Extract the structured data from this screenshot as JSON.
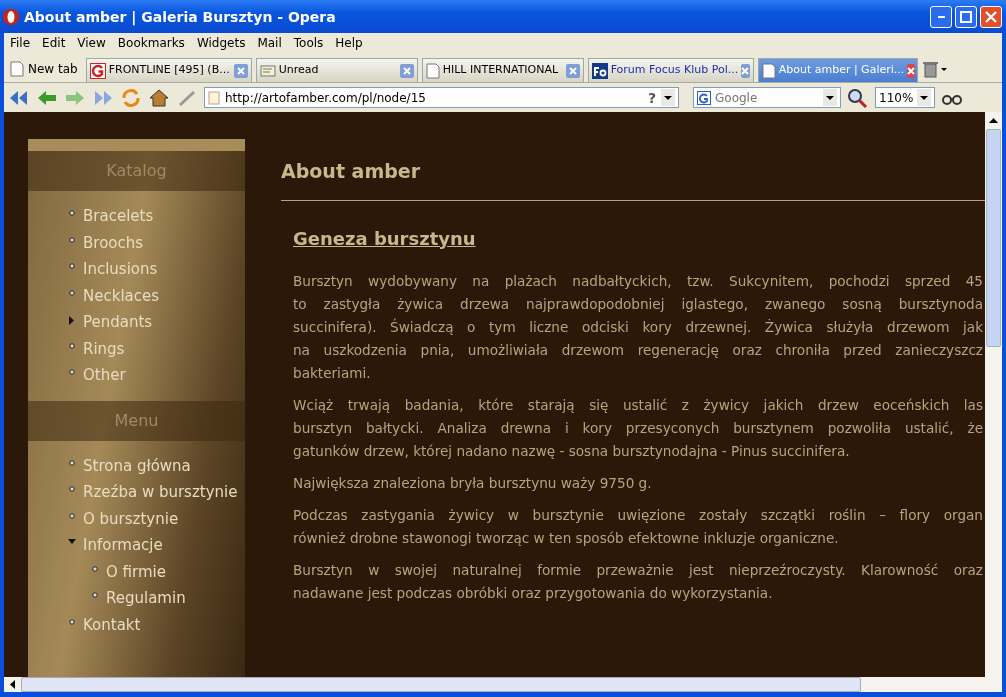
{
  "window": {
    "title": "About amber | Galeria Bursztyn - Opera"
  },
  "menu": [
    "File",
    "Edit",
    "View",
    "Bookmarks",
    "Widgets",
    "Mail",
    "Tools",
    "Help"
  ],
  "new_tab": "New tab",
  "tabs": [
    {
      "label": "FRONTLINE [495] (B...",
      "selected": false
    },
    {
      "label": "Unread",
      "selected": false
    },
    {
      "label": "HILL INTERNATIONAL",
      "selected": false
    },
    {
      "label": "Forum Focus Klub Pol...",
      "selected": false
    },
    {
      "label": "About amber | Galeri...",
      "selected": true
    }
  ],
  "address": "http://artofamber.com/pl/node/15",
  "help_button": "?",
  "search": {
    "placeholder": "Google"
  },
  "zoom": "110%",
  "sidebar": [
    {
      "title": "Katalog",
      "items": [
        {
          "label": "Bracelets"
        },
        {
          "label": "Broochs"
        },
        {
          "label": "Inclusions"
        },
        {
          "label": "Necklaces"
        },
        {
          "label": "Pendants",
          "expanded": false
        },
        {
          "label": "Rings"
        },
        {
          "label": "Other"
        }
      ]
    },
    {
      "title": "Menu",
      "items": [
        {
          "label": "Strona główna"
        },
        {
          "label": "Rzeźba w bursztynie"
        },
        {
          "label": "O bursztynie"
        },
        {
          "label": "Informacje",
          "expanded": true,
          "children": [
            {
              "label": "O firmie"
            },
            {
              "label": "Regulamin"
            }
          ]
        },
        {
          "label": "Kontakt"
        }
      ]
    }
  ],
  "page_title": "About amber",
  "section_title": "Geneza bursztynu",
  "paragraphs": [
    [
      "Bursztyn wydobywany na plażach nadbałtyckich, tzw. Sukcynitem, pochodzi sprzed 45",
      "to zastygła żywica drzewa najprawdopodobniej iglastego, zwanego sosną bursztynoda",
      "succinifera). Świadczą o tym liczne odciski kory drzewnej. Żywica służyła drzewom jak",
      "na uszkodzenia pnia, umożliwiała drzewom regenerację oraz chroniła przed zanieczyszcz",
      "bakteriami."
    ],
    [
      "Wciąż trwają badania, które starają się ustalić z żywicy jakich drzew eoceńskich las",
      "bursztyn bałtycki. Analiza drewna i kory przesyconych bursztynem pozwoliła ustalić, że",
      "gatunków drzew, której nadano nazwę - sosna bursztynodajna - Pinus succinifera."
    ],
    [
      "Największa znaleziona bryła bursztynu waży 9750 g."
    ],
    [
      "Podczas zastygania żywicy w bursztynie uwięzione zostały szczątki roślin – flory organ",
      "również drobne stawonogi tworząc w ten sposób efektowne inkluzje organiczne."
    ],
    [
      "Bursztyn w swojej naturalnej formie przeważnie jest nieprzeźroczysty. Klarowność oraz",
      "nadawane jest podczas obróbki oraz przygotowania do wykorzystania."
    ]
  ]
}
